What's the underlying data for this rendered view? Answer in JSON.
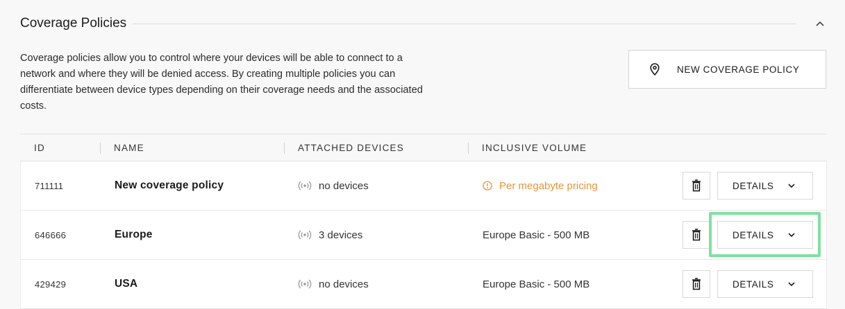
{
  "section": {
    "title": "Coverage Policies",
    "description": "Coverage policies allow you to control where your devices will be able to connect to a network and where they will be denied access. By creating multiple policies you can differentiate between device types depending on their coverage needs and the associated costs."
  },
  "actions": {
    "new_policy_label": "NEW COVERAGE POLICY"
  },
  "table": {
    "columns": [
      "ID",
      "NAME",
      "ATTACHED DEVICES",
      "INCLUSIVE VOLUME"
    ],
    "rows": [
      {
        "id": "711111",
        "name": "New coverage policy",
        "devices": "no devices",
        "volume": "Per megabyte pricing",
        "details_label": "DETAILS"
      },
      {
        "id": "646666",
        "name": "Europe",
        "devices": "3 devices",
        "volume": "Europe Basic - 500 MB",
        "details_label": "DETAILS"
      },
      {
        "id": "429429",
        "name": "USA",
        "devices": "no devices",
        "volume": "Europe Basic - 500 MB",
        "details_label": "DETAILS"
      }
    ]
  },
  "colors": {
    "warning": "#e8943a",
    "highlight": "#7fe0a0"
  }
}
